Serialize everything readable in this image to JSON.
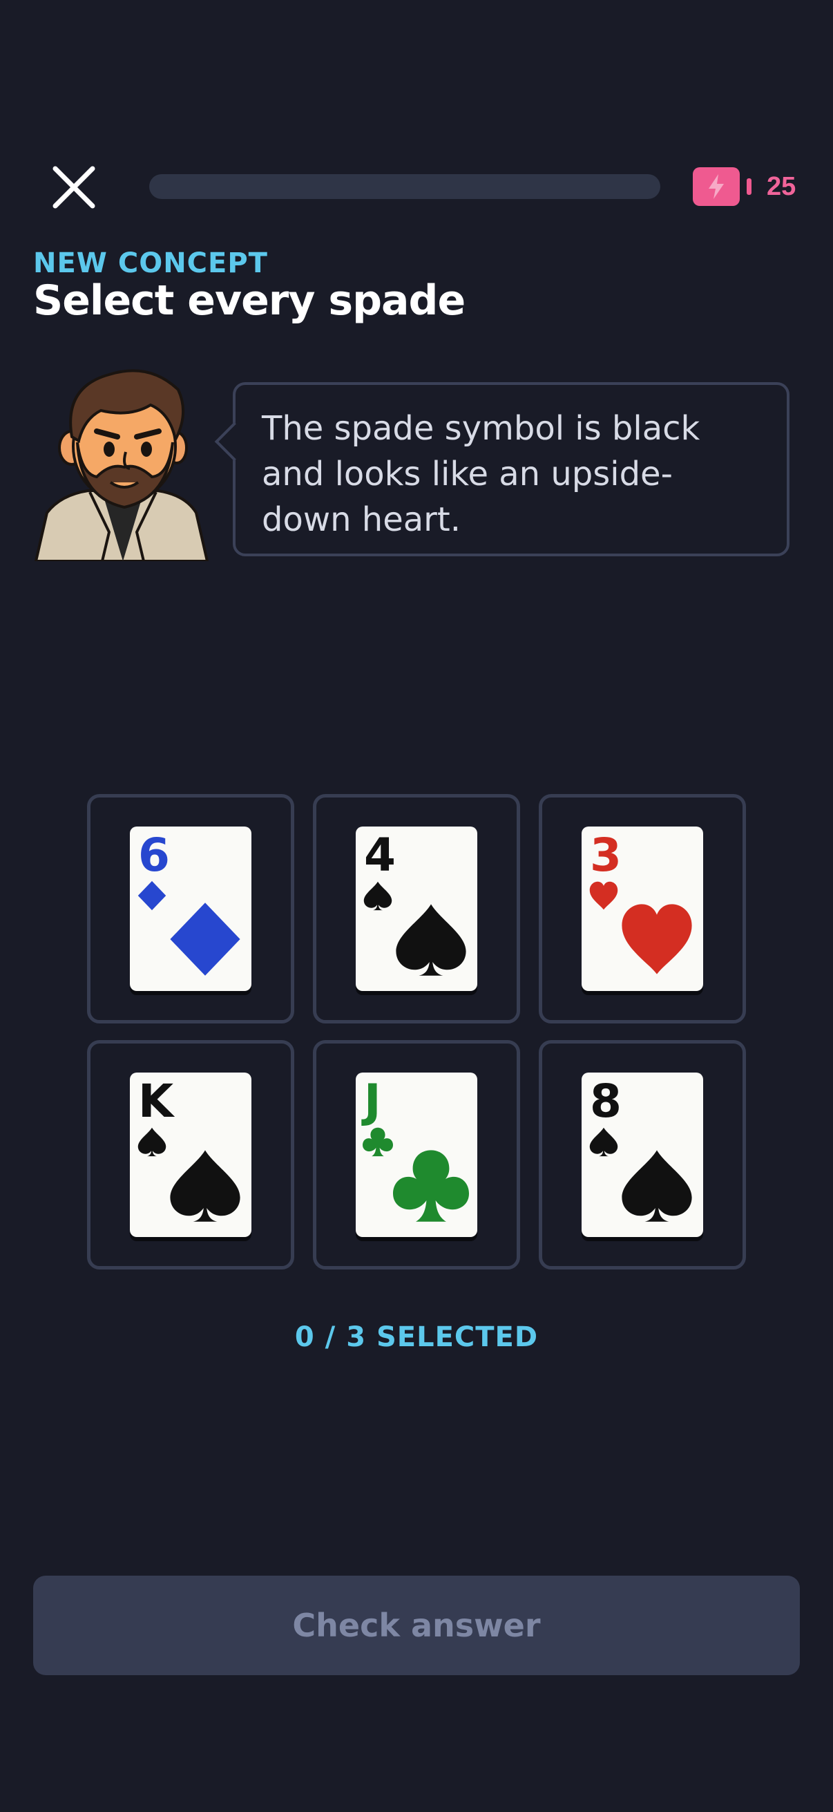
{
  "header": {
    "close_icon": "close-icon",
    "progress": 0,
    "energy_icon": "lightning-battery-icon",
    "energy_count": "25",
    "energy_color": "#ef5a90"
  },
  "lesson": {
    "eyebrow": "NEW CONCEPT",
    "title": "Select every spade"
  },
  "tutor": {
    "avatar_icon": "bearded-man-avatar",
    "message": "The spade symbol is black and looks like an upside-down heart."
  },
  "cards": [
    {
      "rank": "6",
      "suit": "diamond",
      "color": "#2747cf"
    },
    {
      "rank": "4",
      "suit": "spade",
      "color": "#111111"
    },
    {
      "rank": "3",
      "suit": "heart",
      "color": "#d42e22"
    },
    {
      "rank": "K",
      "suit": "spade",
      "color": "#111111"
    },
    {
      "rank": "J",
      "suit": "club",
      "color": "#1f8a2e"
    },
    {
      "rank": "8",
      "suit": "spade",
      "color": "#111111"
    }
  ],
  "selection": {
    "counter": "0 / 3 SELECTED"
  },
  "footer": {
    "check_label": "Check answer"
  }
}
